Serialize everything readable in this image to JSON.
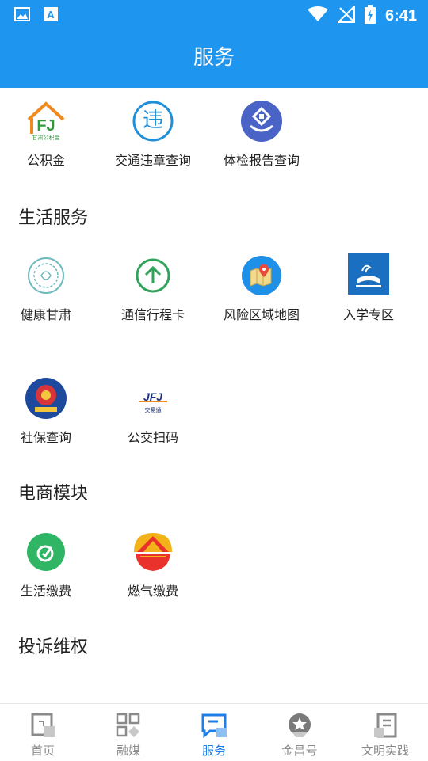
{
  "status_bar": {
    "time": "6:41"
  },
  "app_bar": {
    "title": "服务"
  },
  "top_services": [
    {
      "label": "公积金",
      "icon": "housing-fund-icon",
      "logo_text": "甘肃公积金"
    },
    {
      "label": "交通违章查询",
      "icon": "traffic-violation-icon",
      "icon_char": "违"
    },
    {
      "label": "体检报告查询",
      "icon": "health-report-icon"
    }
  ],
  "life_services": {
    "title": "生活服务",
    "items": [
      {
        "label": "健康甘肃",
        "icon": "health-gansu-icon"
      },
      {
        "label": "通信行程卡",
        "icon": "travel-card-icon"
      },
      {
        "label": "风险区域地图",
        "icon": "risk-map-icon"
      },
      {
        "label": "入学专区",
        "icon": "enrollment-icon"
      },
      {
        "label": "社保查询",
        "icon": "social-security-icon"
      },
      {
        "label": "公交扫码",
        "icon": "bus-scan-icon",
        "logo_text": "交易通"
      }
    ]
  },
  "ecommerce": {
    "title": "电商模块",
    "items": [
      {
        "label": "生活缴费",
        "icon": "utility-payment-icon"
      },
      {
        "label": "燃气缴费",
        "icon": "gas-payment-icon"
      }
    ]
  },
  "complaints": {
    "title": "投诉维权"
  },
  "bottom_nav": [
    {
      "label": "首页",
      "icon": "home-icon",
      "active": false
    },
    {
      "label": "融媒",
      "icon": "media-icon",
      "active": false
    },
    {
      "label": "服务",
      "icon": "service-icon",
      "active": true
    },
    {
      "label": "金昌号",
      "icon": "jinchang-icon",
      "active": false
    },
    {
      "label": "文明实践",
      "icon": "civilization-icon",
      "active": false
    }
  ],
  "colors": {
    "primary": "#1e96f0",
    "active_nav": "#1e7fe6",
    "inactive_nav": "#8a8a8a"
  }
}
